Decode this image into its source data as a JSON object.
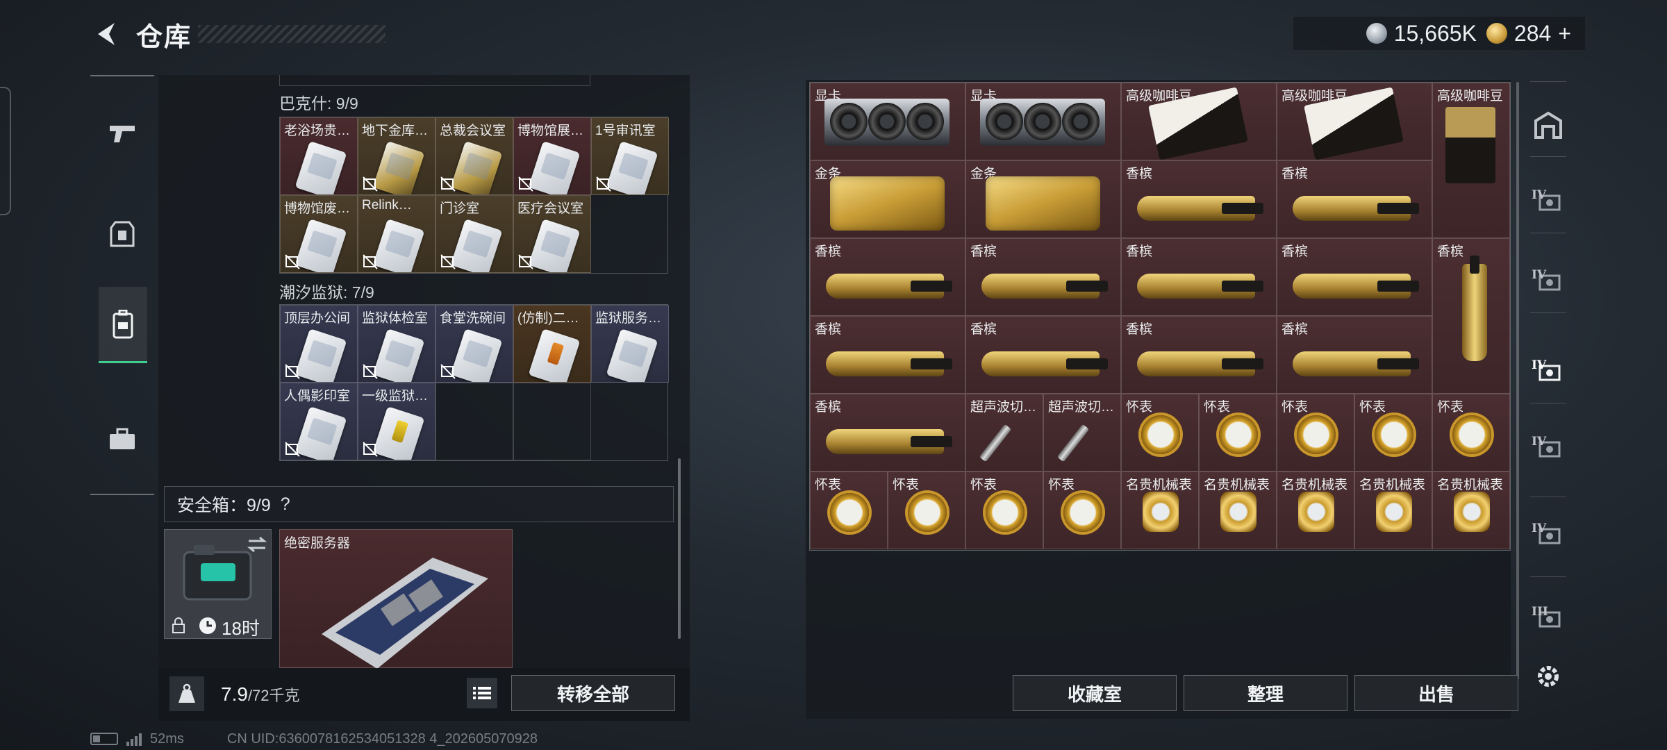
{
  "header": {
    "title": "仓库",
    "silver": "15,665K",
    "gold": "284",
    "gold_plus": "+"
  },
  "left": {
    "sections": [
      {
        "title": "巴克什: 9/9"
      },
      {
        "title": "潮汐监狱: 7/9"
      }
    ],
    "bakeshi_items": [
      "老浴场贵…",
      "地下金库…",
      "总裁会议室",
      "博物馆展…",
      "1号审讯室",
      "博物馆废…",
      "Relink…",
      "门诊室",
      "医疗会议室"
    ],
    "prison_items": [
      "顶层办公间",
      "监狱体检室",
      "食堂洗碗间",
      "(仿制)二…",
      "监狱服务…",
      "人偶影印室",
      "一级监狱…"
    ],
    "safe_box": {
      "label": "安全箱：9/9",
      "help": "?",
      "timer": "18时",
      "server_label": "绝密服务器"
    },
    "weight": {
      "current": "7.9",
      "max": "/72千克"
    },
    "transfer_all": "转移全部"
  },
  "right": {
    "items": [
      "显卡",
      "显卡",
      "高级咖啡豆",
      "高级咖啡豆",
      "高级咖啡豆",
      "金条",
      "金条",
      "香槟",
      "香槟",
      "香槟",
      "香槟",
      "香槟",
      "香槟",
      "香槟",
      "香槟",
      "香槟",
      "香槟",
      "香槟",
      "香槟",
      "超声波切…",
      "超声波切…",
      "怀表",
      "怀表",
      "怀表",
      "怀表",
      "怀表",
      "怀表",
      "怀表",
      "怀表",
      "怀表",
      "名贵机械表",
      "名贵机械表",
      "名贵机械表",
      "名贵机械表",
      "名贵机械表"
    ],
    "buttons": {
      "collection": "收藏室",
      "organize": "整理",
      "sell": "出售"
    },
    "side_tiers": [
      "IV",
      "IV",
      "IV",
      "IV",
      "IV",
      "III"
    ]
  },
  "status": {
    "ping": "52ms",
    "uid": "CN UID:6360078162534051328 4_202605070928"
  }
}
